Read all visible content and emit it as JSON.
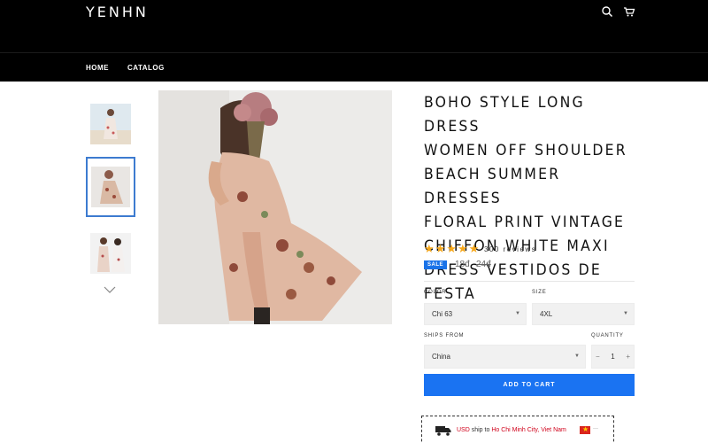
{
  "header": {
    "logo": "YENHN",
    "icons": [
      "search-icon",
      "cart-icon"
    ],
    "nav": [
      "HOME",
      "CATALOG"
    ]
  },
  "gallery": {
    "thumbnails": 3,
    "active_thumbnail": 2
  },
  "product": {
    "title_lines": [
      "BOHO STYLE LONG DRESS",
      "WOMEN OFF SHOULDER",
      "BEACH SUMMER DRESSES",
      "FLORAL PRINT VINTAGE",
      "CHIFFON WHITE MAXI",
      "DRESS VESTIDOS DE FESTA"
    ],
    "rating_stars": 5,
    "reviews": "300 reviews",
    "sale_badge": "SALE",
    "price": "18đ",
    "compare_price": "24đ"
  },
  "options": {
    "color_label": "COLOR",
    "color_value": "Chi 63",
    "size_label": "SIZE",
    "size_value": "4XL",
    "ships_from_label": "SHIPS FROM",
    "ships_from_value": "China",
    "quantity_label": "QUANTITY",
    "quantity_value": "1",
    "qty_minus": "−",
    "qty_plus": "+"
  },
  "add_to_cart": "ADD TO CART",
  "shipping": {
    "currency": "USD",
    "ship_to": "ship to",
    "location": "Ho Chi Minh City, Viet Nam",
    "more": "···"
  },
  "colors": {
    "accent": "#1a73f2",
    "star": "#f7a81b",
    "header_bg": "#000000"
  }
}
